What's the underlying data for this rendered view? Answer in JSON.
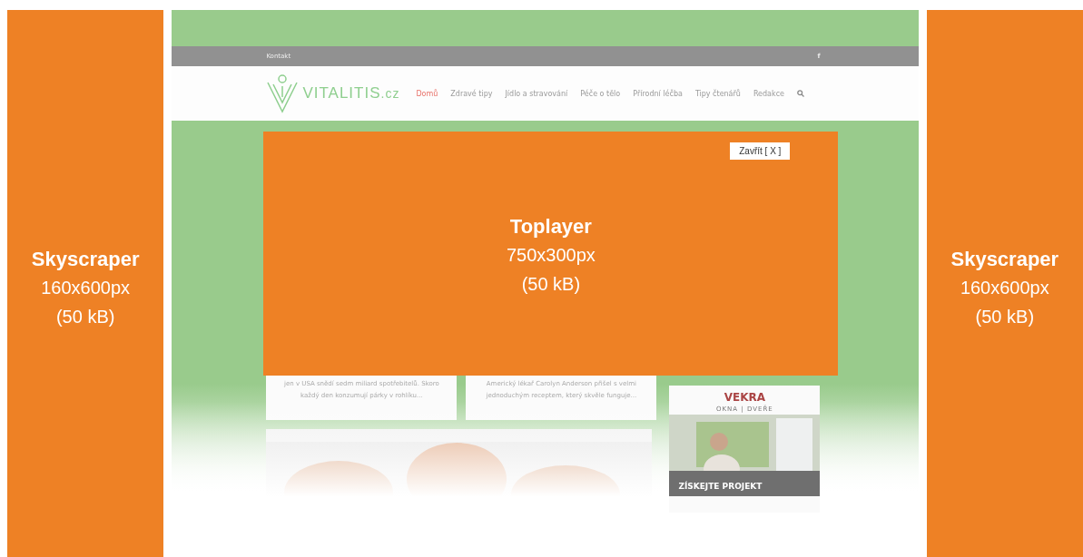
{
  "skyscraper_left": {
    "title": "Skyscraper",
    "size": "160x600px",
    "weight": "(50 kB)"
  },
  "website": {
    "top_bar": {
      "link": "Kontakt",
      "social_icon": "f"
    },
    "logo": {
      "name": "VITALITIS",
      "suffix": ".cz"
    },
    "nav": [
      {
        "label": "Domů",
        "selected": true
      },
      {
        "label": "Zdravé tipy",
        "selected": false
      },
      {
        "label": "Jídlo a stravování",
        "selected": false
      },
      {
        "label": "Péče o tělo",
        "selected": false
      },
      {
        "label": "Přírodní léčba",
        "selected": false
      },
      {
        "label": "Tipy čtenářů",
        "selected": false
      },
      {
        "label": "Redakce",
        "selected": false
      }
    ],
    "cards": [
      {
        "excerpt": "jen v USA snědí sedm miliard spotřebitelů. Skoro každý den konzumují párky v rohlíku..."
      },
      {
        "excerpt": "Americký lékař Carolyn Anderson přišel s velmi jednoduchým receptem, který skvěle funguje..."
      }
    ],
    "ad": {
      "brand": "VEKRA",
      "tagline": "OKNA | DVEŘE",
      "cta": "ZÍSKEJTE PROJEKT"
    }
  },
  "toplayer": {
    "close": "Zavřít [ X ]",
    "title": "Toplayer",
    "size": "750x300px",
    "weight": "(50 kB)"
  },
  "skyscraper_right": {
    "title": "Skyscraper",
    "size": "160x600px",
    "weight": "(50 kB)"
  }
}
